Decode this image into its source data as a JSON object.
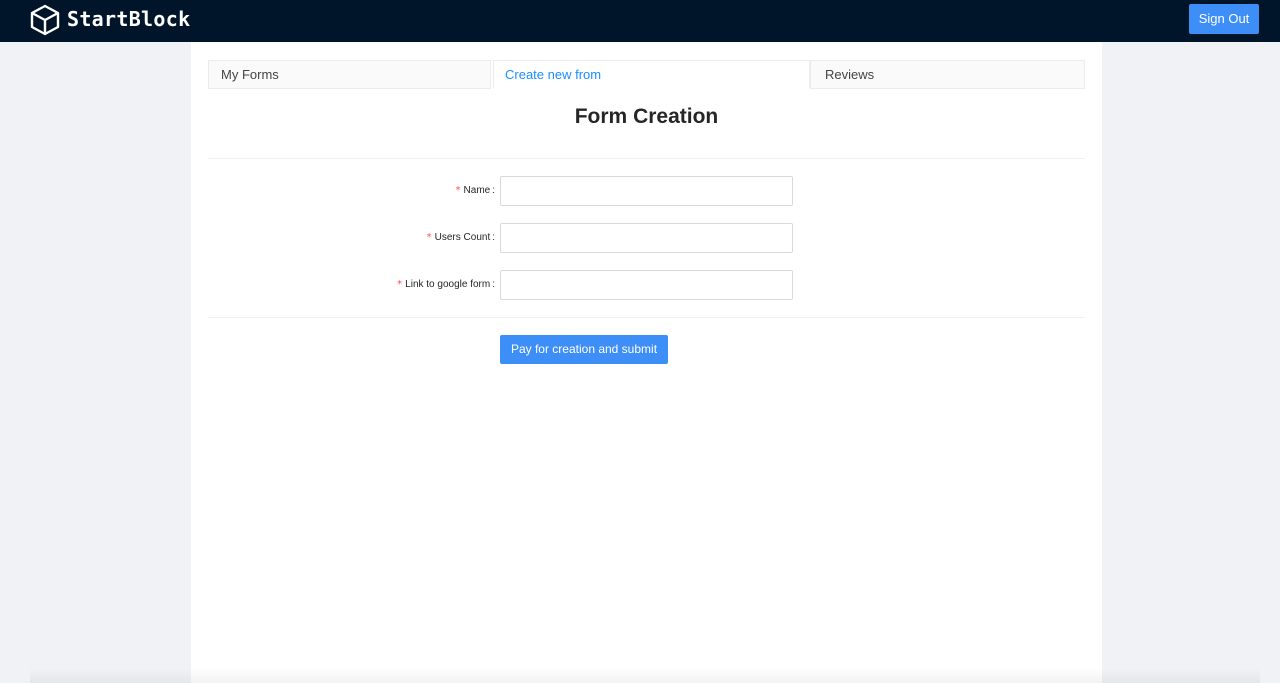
{
  "header": {
    "brand": "StartBlock",
    "logo_icon": "cube-icon",
    "sign_out_label": "Sign Out",
    "background_color": "#001529"
  },
  "tabs": [
    {
      "label": "My Forms",
      "active": false
    },
    {
      "label": "Create new from",
      "active": true
    },
    {
      "label": "Reviews",
      "active": false
    }
  ],
  "form": {
    "title": "Form Creation",
    "required_mark": "*",
    "colon": ":",
    "fields": [
      {
        "label": "Name",
        "value": "",
        "required": true
      },
      {
        "label": "Users Count",
        "value": "",
        "required": true
      },
      {
        "label": "Link to google form",
        "value": "",
        "required": true
      }
    ],
    "submit_label": "Pay for creation and submit"
  },
  "colors": {
    "primary": "#3e8ef7",
    "active_tab": "#1890ff",
    "required": "#ff4d4f",
    "page_background": "#f0f2f5"
  }
}
